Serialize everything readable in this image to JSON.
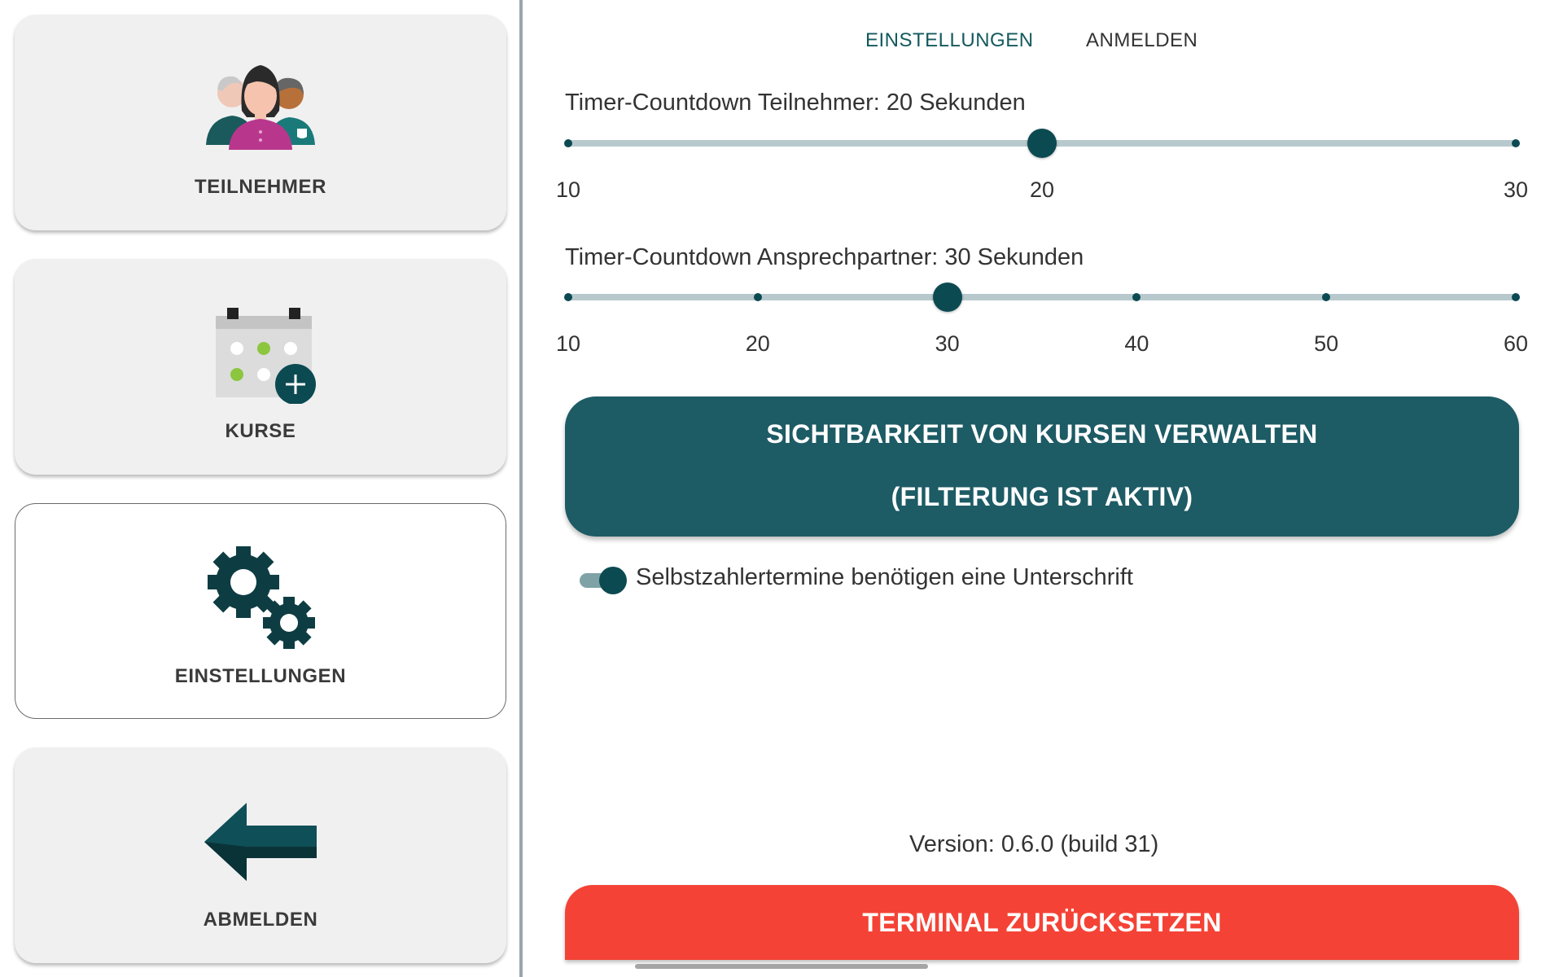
{
  "nav": {
    "items": [
      {
        "label": "TEILNEHMER",
        "icon": "participants-icon"
      },
      {
        "label": "KURSE",
        "icon": "calendar-add-icon"
      },
      {
        "label": "EINSTELLUNGEN",
        "icon": "gears-icon",
        "active": true
      },
      {
        "label": "ABMELDEN",
        "icon": "back-arrow-icon"
      }
    ]
  },
  "tabs": {
    "settings": "EINSTELLUNGEN",
    "login": "ANMELDEN"
  },
  "settings": {
    "participant_timer": {
      "label": "Timer-Countdown Teilnehmer: 20 Sekunden",
      "value": 20,
      "min": 10,
      "max": 30,
      "step": 10,
      "tick_labels": [
        "10",
        "20",
        "30"
      ]
    },
    "contact_timer": {
      "label": "Timer-Countdown Ansprechpartner: 30 Sekunden",
      "value": 30,
      "min": 10,
      "max": 60,
      "step": 10,
      "tick_labels": [
        "10",
        "20",
        "30",
        "40",
        "50",
        "60"
      ]
    },
    "visibility_button": {
      "line1": "SICHTBARKEIT VON KURSEN VERWALTEN",
      "line2": "(FILTERUNG IST AKTIV)"
    },
    "signature_toggle": {
      "label": "Selbstzahlertermine benötigen eine Unterschrift",
      "on": true
    },
    "version": "Version: 0.6.0 (build 31)",
    "reset_button": "TERMINAL ZURÜCKSETZEN"
  },
  "colors": {
    "primary": "#1d5b65",
    "accent_dark": "#0c4a52",
    "danger": "#f44336",
    "track": "#b7c9cd"
  }
}
